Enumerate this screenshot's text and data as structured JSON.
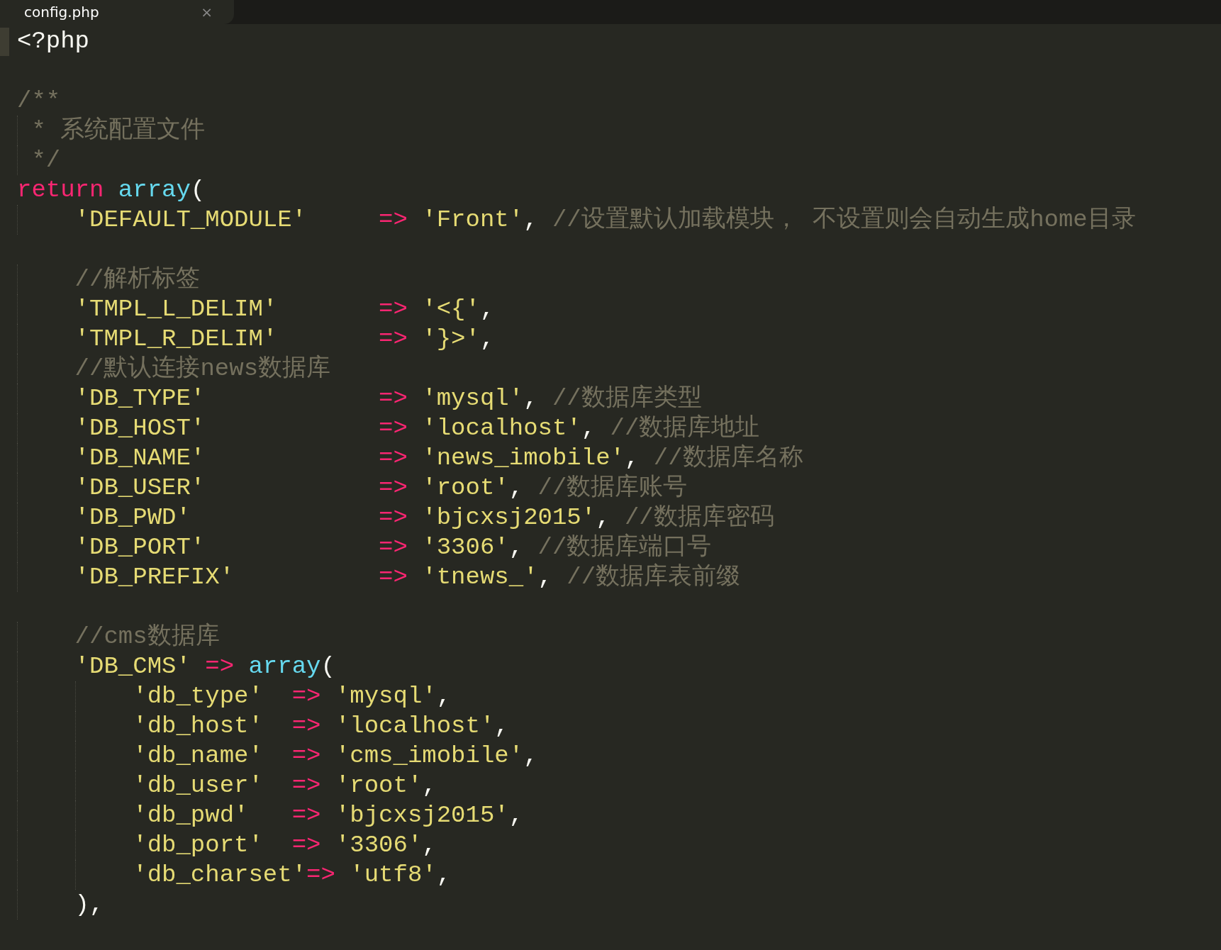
{
  "tabs": [
    {
      "label": "config.php",
      "selected": true,
      "close": "×"
    }
  ],
  "editor": {
    "lines": [
      {
        "current": true,
        "tokens": [
          {
            "kind": "plain",
            "text": "<?php"
          }
        ]
      },
      {
        "current": false
      },
      {
        "current": false,
        "tokens": [
          {
            "kind": "comment",
            "text": "/**"
          }
        ]
      },
      {
        "current": false,
        "tokens": [
          {
            "kind": "comment",
            "text": " * 系统配置文件"
          }
        ]
      },
      {
        "current": false,
        "tokens": [
          {
            "kind": "comment",
            "text": " */"
          }
        ]
      },
      {
        "current": false,
        "tokens": [
          {
            "kind": "keyword",
            "text": "return "
          },
          {
            "kind": "function",
            "text": "array"
          },
          {
            "kind": "plain",
            "text": "("
          }
        ]
      },
      {
        "current": false,
        "tokens": [
          {
            "kind": "string",
            "text": "    'DEFAULT_MODULE'     "
          },
          {
            "kind": "operator",
            "text": "=> "
          },
          {
            "kind": "string",
            "text": "'Front'"
          },
          {
            "kind": "plain",
            "text": ", "
          },
          {
            "kind": "comment",
            "text": "//设置默认加载模块， 不设置则会自动生成home目录"
          }
        ]
      },
      {
        "current": false
      },
      {
        "current": false,
        "tokens": [
          {
            "kind": "comment",
            "text": "    //解析标签"
          }
        ]
      },
      {
        "current": false,
        "tokens": [
          {
            "kind": "string",
            "text": "    'TMPL_L_DELIM'       "
          },
          {
            "kind": "operator",
            "text": "=> "
          },
          {
            "kind": "string",
            "text": "'<{'"
          },
          {
            "kind": "plain",
            "text": ","
          }
        ]
      },
      {
        "current": false,
        "tokens": [
          {
            "kind": "string",
            "text": "    'TMPL_R_DELIM'       "
          },
          {
            "kind": "operator",
            "text": "=> "
          },
          {
            "kind": "string",
            "text": "'}>'"
          },
          {
            "kind": "plain",
            "text": ","
          }
        ]
      },
      {
        "current": false,
        "tokens": [
          {
            "kind": "comment",
            "text": "    //默认连接news数据库"
          }
        ]
      },
      {
        "current": false,
        "tokens": [
          {
            "kind": "string",
            "text": "    'DB_TYPE'            "
          },
          {
            "kind": "operator",
            "text": "=> "
          },
          {
            "kind": "string",
            "text": "'mysql'"
          },
          {
            "kind": "plain",
            "text": ", "
          },
          {
            "kind": "comment",
            "text": "//数据库类型"
          }
        ]
      },
      {
        "current": false,
        "tokens": [
          {
            "kind": "string",
            "text": "    'DB_HOST'            "
          },
          {
            "kind": "operator",
            "text": "=> "
          },
          {
            "kind": "string",
            "text": "'localhost'"
          },
          {
            "kind": "plain",
            "text": ", "
          },
          {
            "kind": "comment",
            "text": "//数据库地址"
          }
        ]
      },
      {
        "current": false,
        "tokens": [
          {
            "kind": "string",
            "text": "    'DB_NAME'            "
          },
          {
            "kind": "operator",
            "text": "=> "
          },
          {
            "kind": "string",
            "text": "'news_imobile'"
          },
          {
            "kind": "plain",
            "text": ", "
          },
          {
            "kind": "comment",
            "text": "//数据库名称"
          }
        ]
      },
      {
        "current": false,
        "tokens": [
          {
            "kind": "string",
            "text": "    'DB_USER'            "
          },
          {
            "kind": "operator",
            "text": "=> "
          },
          {
            "kind": "string",
            "text": "'root'"
          },
          {
            "kind": "plain",
            "text": ", "
          },
          {
            "kind": "comment",
            "text": "//数据库账号"
          }
        ]
      },
      {
        "current": false,
        "tokens": [
          {
            "kind": "string",
            "text": "    'DB_PWD'             "
          },
          {
            "kind": "operator",
            "text": "=> "
          },
          {
            "kind": "string",
            "text": "'bjcxsj2015'"
          },
          {
            "kind": "plain",
            "text": ", "
          },
          {
            "kind": "comment",
            "text": "//数据库密码"
          }
        ]
      },
      {
        "current": false,
        "tokens": [
          {
            "kind": "string",
            "text": "    'DB_PORT'            "
          },
          {
            "kind": "operator",
            "text": "=> "
          },
          {
            "kind": "string",
            "text": "'3306'"
          },
          {
            "kind": "plain",
            "text": ", "
          },
          {
            "kind": "comment",
            "text": "//数据库端口号"
          }
        ]
      },
      {
        "current": false,
        "tokens": [
          {
            "kind": "string",
            "text": "    'DB_PREFIX'          "
          },
          {
            "kind": "operator",
            "text": "=> "
          },
          {
            "kind": "string",
            "text": "'tnews_'"
          },
          {
            "kind": "plain",
            "text": ", "
          },
          {
            "kind": "comment",
            "text": "//数据库表前缀"
          }
        ]
      },
      {
        "current": false
      },
      {
        "current": false,
        "tokens": [
          {
            "kind": "comment",
            "text": "    //cms数据库"
          }
        ]
      },
      {
        "current": false,
        "tokens": [
          {
            "kind": "string",
            "text": "    'DB_CMS' "
          },
          {
            "kind": "operator",
            "text": "=> "
          },
          {
            "kind": "function",
            "text": "array"
          },
          {
            "kind": "plain",
            "text": "("
          }
        ]
      },
      {
        "current": false,
        "tokens": [
          {
            "kind": "string",
            "text": "        'db_type'  "
          },
          {
            "kind": "operator",
            "text": "=> "
          },
          {
            "kind": "string",
            "text": "'mysql'"
          },
          {
            "kind": "plain",
            "text": ","
          }
        ]
      },
      {
        "current": false,
        "tokens": [
          {
            "kind": "string",
            "text": "        'db_host'  "
          },
          {
            "kind": "operator",
            "text": "=> "
          },
          {
            "kind": "string",
            "text": "'localhost'"
          },
          {
            "kind": "plain",
            "text": ","
          }
        ]
      },
      {
        "current": false,
        "tokens": [
          {
            "kind": "string",
            "text": "        'db_name'  "
          },
          {
            "kind": "operator",
            "text": "=> "
          },
          {
            "kind": "string",
            "text": "'cms_imobile'"
          },
          {
            "kind": "plain",
            "text": ","
          }
        ]
      },
      {
        "current": false,
        "tokens": [
          {
            "kind": "string",
            "text": "        'db_user'  "
          },
          {
            "kind": "operator",
            "text": "=> "
          },
          {
            "kind": "string",
            "text": "'root'"
          },
          {
            "kind": "plain",
            "text": ","
          }
        ]
      },
      {
        "current": false,
        "tokens": [
          {
            "kind": "string",
            "text": "        'db_pwd'   "
          },
          {
            "kind": "operator",
            "text": "=> "
          },
          {
            "kind": "string",
            "text": "'bjcxsj2015'"
          },
          {
            "kind": "plain",
            "text": ","
          }
        ]
      },
      {
        "current": false,
        "tokens": [
          {
            "kind": "string",
            "text": "        'db_port'  "
          },
          {
            "kind": "operator",
            "text": "=> "
          },
          {
            "kind": "string",
            "text": "'3306'"
          },
          {
            "kind": "plain",
            "text": ","
          }
        ]
      },
      {
        "current": false,
        "tokens": [
          {
            "kind": "string",
            "text": "        'db_charset'"
          },
          {
            "kind": "operator",
            "text": "=> "
          },
          {
            "kind": "string",
            "text": "'utf8'"
          },
          {
            "kind": "plain",
            "text": ","
          }
        ]
      },
      {
        "current": false,
        "tokens": [
          {
            "kind": "plain",
            "text": "    ),"
          }
        ]
      }
    ]
  }
}
